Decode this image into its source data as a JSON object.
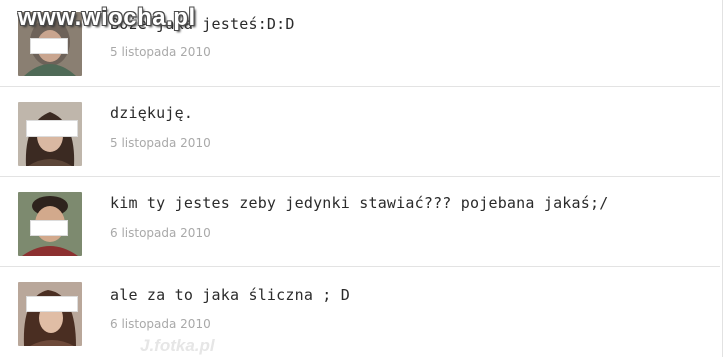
{
  "watermarks": {
    "top": "www.wiocha.pl",
    "bottom": "J.fotka.pl"
  },
  "comments": [
    {
      "text": "Boże jaka jesteś:D:D",
      "date": "5 listopada 2010",
      "avatar_icon": "user-avatar-icon"
    },
    {
      "text": "dziękuję.",
      "date": "5 listopada 2010",
      "avatar_icon": "user-avatar-icon"
    },
    {
      "text": "kim ty jestes zeby jedynki stawiać??? pojebana jakaś;/",
      "date": "6 listopada 2010",
      "avatar_icon": "user-avatar-icon"
    },
    {
      "text": "ale za to jaka śliczna ; D",
      "date": "6 listopada 2010",
      "avatar_icon": "user-avatar-icon"
    }
  ],
  "colors": {
    "text": "#2b2b2b",
    "date": "#a9a9a9",
    "divider": "#e3e3e3"
  }
}
